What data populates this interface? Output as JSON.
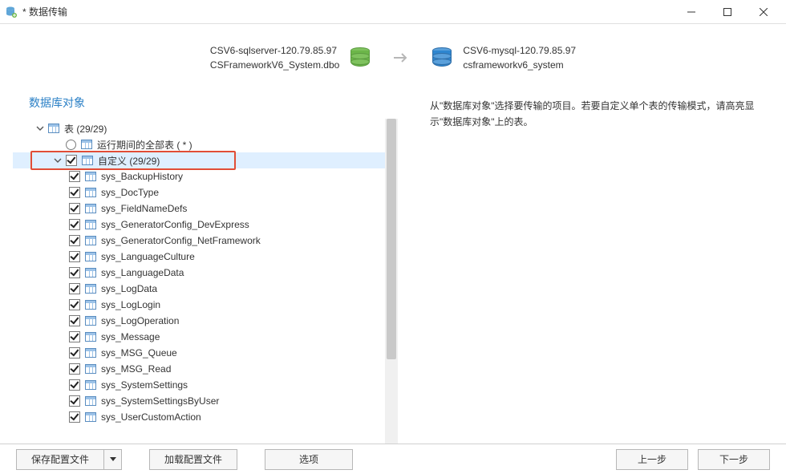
{
  "window": {
    "title": "* 数据传输"
  },
  "conn": {
    "source": {
      "line1": "CSV6-sqlserver-120.79.85.97",
      "line2": "CSFrameworkV6_System.dbo",
      "color": "#6cb649"
    },
    "target": {
      "line1": "CSV6-mysql-120.79.85.97",
      "line2": "csframeworkv6_system",
      "color": "#2e86d0"
    }
  },
  "left": {
    "section_title": "数据库对象",
    "root": {
      "label": "表 (29/29)"
    },
    "runtime_all": {
      "label": "运行期间的全部表 ( * )"
    },
    "custom_group": {
      "label": "自定义 (29/29)"
    },
    "tables": [
      "sys_BackupHistory",
      "sys_DocType",
      "sys_FieldNameDefs",
      "sys_GeneratorConfig_DevExpress",
      "sys_GeneratorConfig_NetFramework",
      "sys_LanguageCulture",
      "sys_LanguageData",
      "sys_LogData",
      "sys_LogLogin",
      "sys_LogOperation",
      "sys_Message",
      "sys_MSG_Queue",
      "sys_MSG_Read",
      "sys_SystemSettings",
      "sys_SystemSettingsByUser",
      "sys_UserCustomAction"
    ]
  },
  "right": {
    "hint": "从\"数据库对象\"选择要传输的项目。若要自定义单个表的传输模式，请高亮显示\"数据库对象\"上的表。"
  },
  "bottom": {
    "save_profile": "保存配置文件",
    "load_profile": "加载配置文件",
    "options": "选项",
    "prev": "上一步",
    "next": "下一步"
  }
}
